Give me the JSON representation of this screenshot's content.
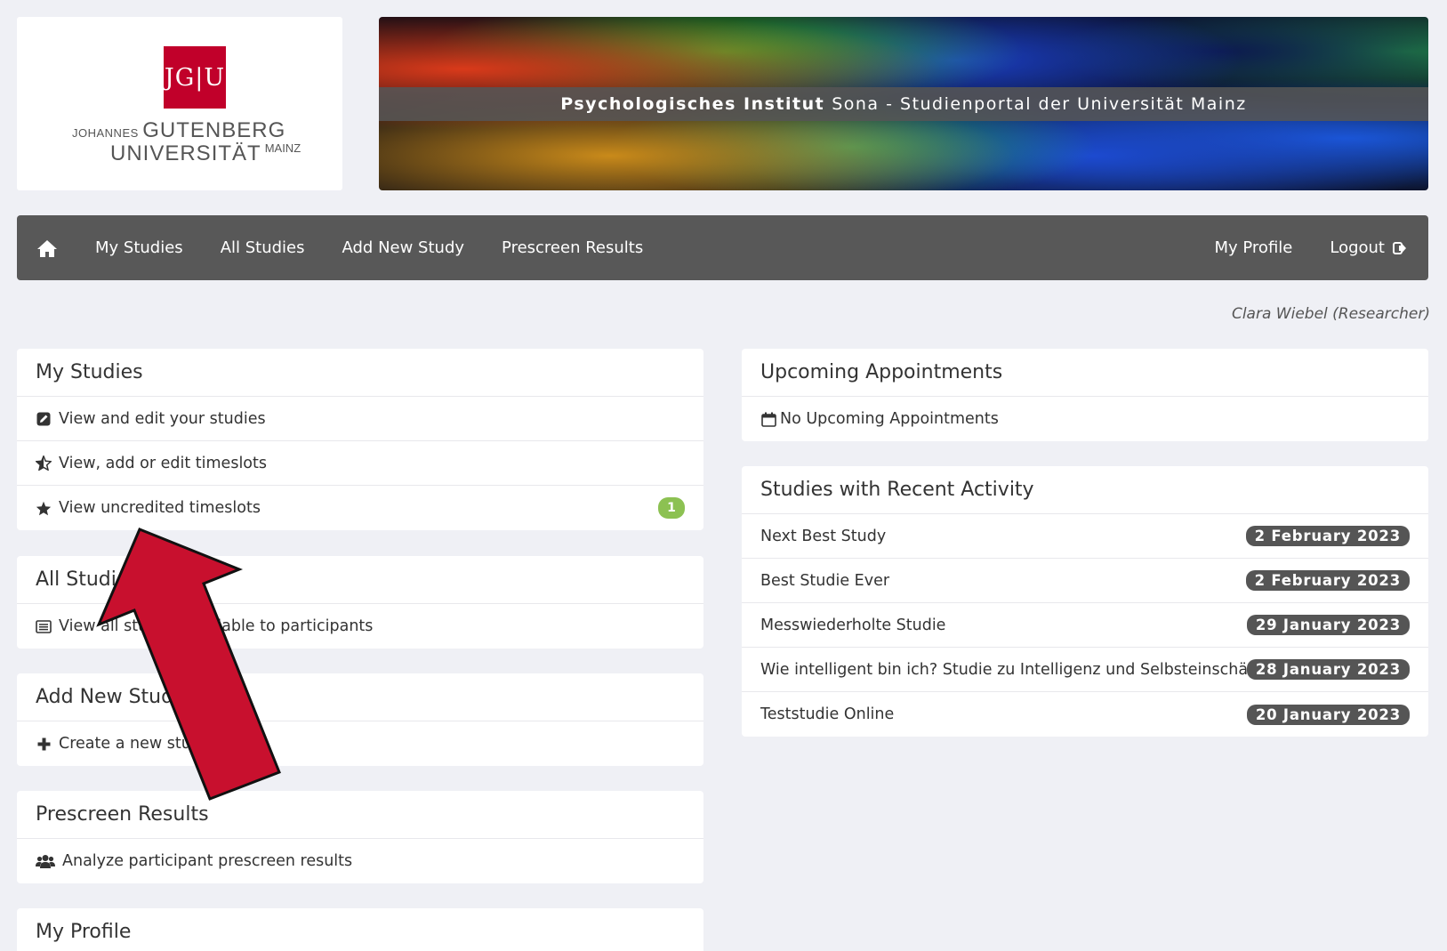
{
  "logo": {
    "mark": "JG|U",
    "line1_small": "JOHANNES",
    "line1_big": "GUTENBERG",
    "line2_big": "UNIVERSITÄT",
    "line2_small": "MAINZ"
  },
  "banner": {
    "title_bold": "Psychologisches Institut",
    "title_rest": "Sona - Studienportal der Universität Mainz"
  },
  "navbar": {
    "home_icon": "home-icon",
    "items": [
      "My Studies",
      "All Studies",
      "Add New Study",
      "Prescreen Results"
    ],
    "right": {
      "profile": "My Profile",
      "logout": "Logout"
    }
  },
  "user": "Clara Wiebel (Researcher)",
  "left_panels": {
    "my_studies": {
      "title": "My Studies",
      "rows": [
        {
          "icon": "edit-icon",
          "label": "View and edit your studies"
        },
        {
          "icon": "star-half-icon",
          "label": "View, add or edit timeslots"
        },
        {
          "icon": "star-icon",
          "label": "View uncredited timeslots",
          "badge": "1"
        }
      ]
    },
    "all_studies": {
      "title": "All Studies",
      "rows": [
        {
          "icon": "list-icon",
          "label": "View all studies available to participants"
        }
      ]
    },
    "add_new_study": {
      "title": "Add New Study",
      "rows": [
        {
          "icon": "plus-icon",
          "label": "Create a new study"
        }
      ]
    },
    "prescreen": {
      "title": "Prescreen Results",
      "rows": [
        {
          "icon": "users-icon",
          "label": "Analyze participant prescreen results"
        }
      ]
    },
    "my_profile": {
      "title": "My Profile"
    }
  },
  "right_panels": {
    "upcoming": {
      "title": "Upcoming Appointments",
      "rows": [
        {
          "icon": "calendar-icon",
          "label": "No Upcoming Appointments"
        }
      ]
    },
    "recent": {
      "title": "Studies with Recent Activity",
      "rows": [
        {
          "label": "Next Best Study",
          "date": "2 February 2023"
        },
        {
          "label": "Best Studie Ever",
          "date": "2 February 2023"
        },
        {
          "label": "Messwiederholte Studie",
          "date": "29 January 2023"
        },
        {
          "label": "Wie intelligent bin ich? Studie zu Intelligenz und Selbsteinschätzung",
          "date": "28 January 2023"
        },
        {
          "label": "Teststudie Online",
          "date": "20 January 2023"
        }
      ]
    }
  },
  "colors": {
    "background": "#eff0f5",
    "navbar": "#585858",
    "badge_green": "#8cc152",
    "date_badge": "#555555",
    "jgu_red": "#c1002a",
    "arrow_red": "#c8102e"
  }
}
